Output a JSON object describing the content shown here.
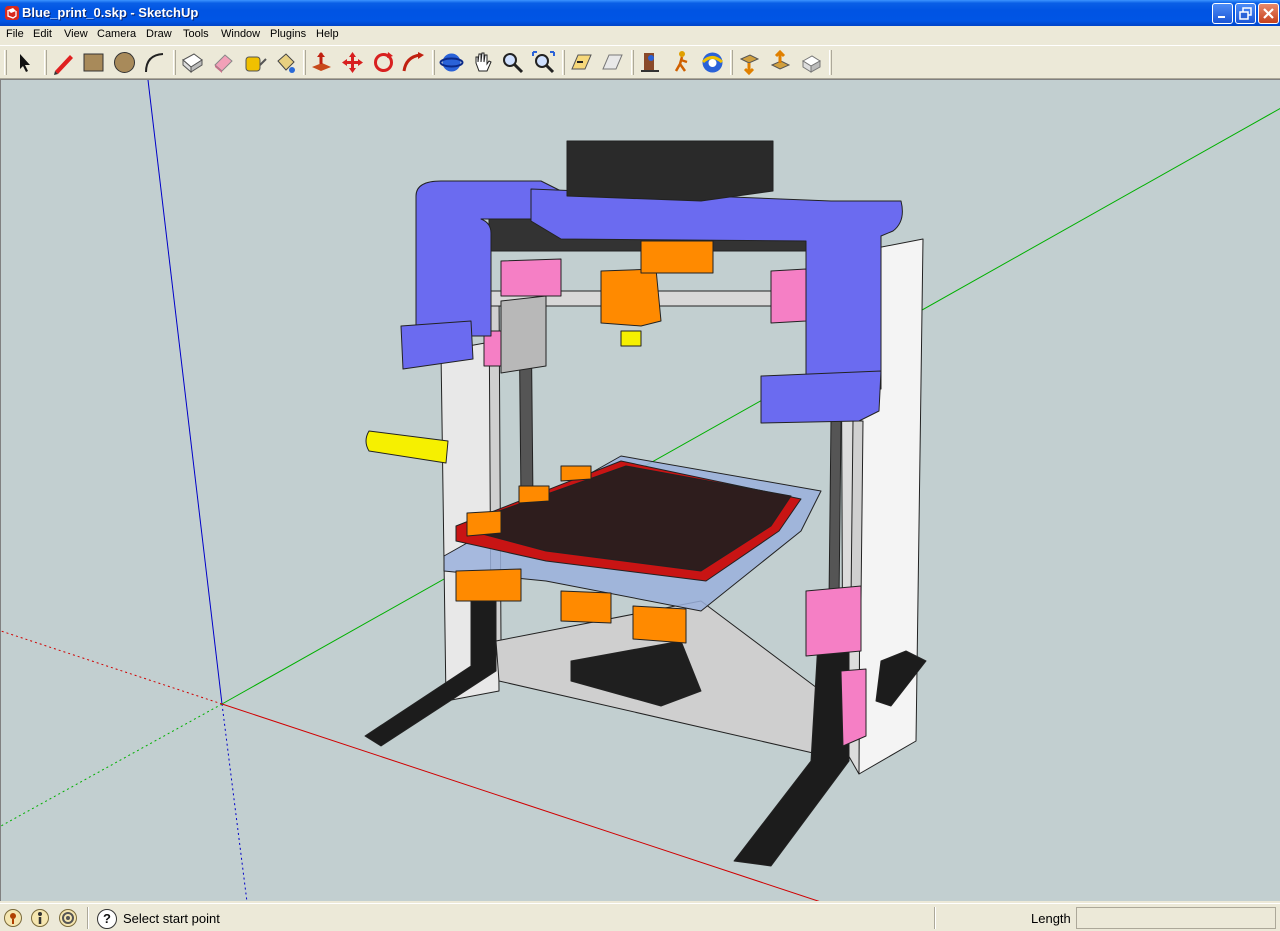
{
  "window": {
    "title": "Blue_print_0.skp - SketchUp"
  },
  "menu": {
    "items": [
      "File",
      "Edit",
      "View",
      "Camera",
      "Draw",
      "Tools",
      "Window",
      "Plugins",
      "Help"
    ]
  },
  "toolbar": {
    "tools": [
      "select-icon",
      "pencil-icon",
      "rectangle-icon",
      "circle-icon",
      "arc-icon",
      "make-component-icon",
      "eraser-icon",
      "tape-measure-icon",
      "paint-bucket-icon",
      "push-pull-icon",
      "move-icon",
      "rotate-icon",
      "follow-me-icon",
      "orbit-icon",
      "pan-icon",
      "zoom-icon",
      "zoom-extents-icon",
      "previous-view-icon",
      "next-view-icon",
      "position-camera-icon",
      "walk-icon",
      "look-around-icon",
      "get-models-icon",
      "share-model-icon",
      "share-component-icon"
    ]
  },
  "status": {
    "hint": "Select start point",
    "length_label": "Length",
    "length_value": ""
  },
  "colors": {
    "viewport_bg": "#c2cfd0",
    "frame_blue": "#6b6bf0",
    "part_pink": "#f57fc5",
    "part_orange": "#ff8a00",
    "bed_dark": "#2e1d1d",
    "bed_red": "#c81414",
    "axis_red": "#d00000",
    "axis_green": "#00b000",
    "axis_blue": "#0000c8"
  }
}
